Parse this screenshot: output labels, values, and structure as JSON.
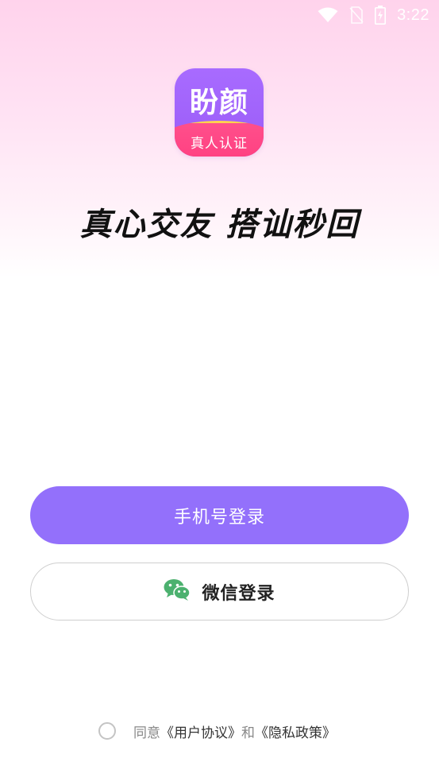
{
  "status_bar": {
    "time": "3:22",
    "icons": [
      "wifi-icon",
      "no-sim-icon",
      "battery-charging-icon"
    ]
  },
  "app": {
    "logo_name": "盼颜",
    "logo_tag": "真人认证",
    "slogan": "真心交友 搭讪秒回"
  },
  "buttons": {
    "phone_login": "手机号登录",
    "wechat_login": "微信登录",
    "wechat_icon": "wechat-icon"
  },
  "agreement": {
    "checked": false,
    "prefix": "同意",
    "user_agreement": "《用户协议》",
    "conjunction": "和",
    "privacy_policy": "《隐私政策》"
  },
  "colors": {
    "primary": "#9370fb",
    "wechat_green": "#4cb16f"
  }
}
